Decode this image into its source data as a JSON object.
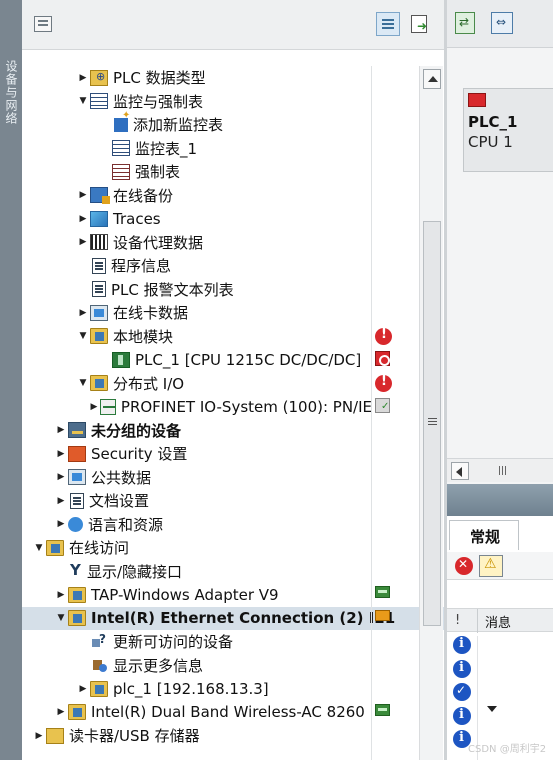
{
  "sidebar": {
    "vertical_title": "设备与网络"
  },
  "tree": {
    "items": [
      {
        "label": "PLC 数据类型",
        "icon": "plc-datatype-icon",
        "expander": "collapsed",
        "indent": 2,
        "bold": false
      },
      {
        "label": "监控与强制表",
        "icon": "watch-force-table-folder-icon",
        "expander": "expanded",
        "indent": 2,
        "bold": false
      },
      {
        "label": "添加新监控表",
        "icon": "add-watch-table-icon",
        "expander": "none",
        "indent": 3,
        "bold": false
      },
      {
        "label": "监控表_1",
        "icon": "watch-table-icon",
        "expander": "none",
        "indent": 3,
        "bold": false
      },
      {
        "label": "强制表",
        "icon": "force-table-icon",
        "expander": "none",
        "indent": 3,
        "bold": false
      },
      {
        "label": "在线备份",
        "icon": "online-backup-icon",
        "expander": "collapsed",
        "indent": 2,
        "bold": false
      },
      {
        "label": "Traces",
        "icon": "traces-icon",
        "expander": "collapsed",
        "indent": 2,
        "bold": false
      },
      {
        "label": "设备代理数据",
        "icon": "device-proxy-icon",
        "expander": "collapsed",
        "indent": 2,
        "bold": false
      },
      {
        "label": "程序信息",
        "icon": "program-info-icon",
        "expander": "none",
        "indent": 2,
        "bold": false
      },
      {
        "label": "PLC 报警文本列表",
        "icon": "alarm-text-icon",
        "expander": "none",
        "indent": 2,
        "bold": false
      },
      {
        "label": "在线卡数据",
        "icon": "memory-card-icon",
        "expander": "collapsed",
        "indent": 2,
        "bold": false
      },
      {
        "label": "本地模块",
        "icon": "folder-icon",
        "expander": "expanded",
        "indent": 2,
        "bold": false
      },
      {
        "label": "PLC_1 [CPU 1215C DC/DC/DC]",
        "icon": "plc-module-icon",
        "expander": "none",
        "indent": 3,
        "bold": false
      },
      {
        "label": "分布式 I/O",
        "icon": "folder-icon",
        "expander": "expanded",
        "indent": 2,
        "bold": false
      },
      {
        "label": "PROFINET IO-System (100): PN/IE",
        "icon": "profinet-system-icon",
        "expander": "collapsed",
        "indent": 3,
        "bold": false
      },
      {
        "label": "未分组的设备",
        "icon": "ungrouped-devices-icon",
        "expander": "collapsed",
        "indent": 1,
        "bold": true
      },
      {
        "label": "Security 设置",
        "icon": "security-icon",
        "expander": "collapsed",
        "indent": 1,
        "bold": false
      },
      {
        "label": "公共数据",
        "icon": "common-data-icon",
        "expander": "collapsed",
        "indent": 1,
        "bold": false
      },
      {
        "label": "文档设置",
        "icon": "document-settings-icon",
        "expander": "collapsed",
        "indent": 1,
        "bold": false
      },
      {
        "label": "语言和资源",
        "icon": "language-icon",
        "expander": "collapsed",
        "indent": 1,
        "bold": false
      },
      {
        "label": "在线访问",
        "icon": "online-access-folder-icon",
        "expander": "expanded",
        "indent": 0,
        "bold": false
      },
      {
        "label": "显示/隐藏接口",
        "icon": "show-hide-interfaces-icon",
        "expander": "none",
        "indent": 1,
        "bold": false
      },
      {
        "label": "TAP-Windows Adapter V9",
        "icon": "folder-icon",
        "expander": "collapsed",
        "indent": 1,
        "bold": false
      },
      {
        "label": "Intel(R) Ethernet Connection (2) I21",
        "icon": "folder-icon",
        "expander": "expanded",
        "indent": 1,
        "bold": true,
        "selected": true
      },
      {
        "label": "更新可访问的设备",
        "icon": "update-accessible-devices-icon",
        "expander": "none",
        "indent": 2,
        "bold": false
      },
      {
        "label": "显示更多信息",
        "icon": "show-more-info-icon",
        "expander": "none",
        "indent": 2,
        "bold": false
      },
      {
        "label": "plc_1 [192.168.13.3]",
        "icon": "plc-online-icon",
        "expander": "collapsed",
        "indent": 2,
        "bold": false
      },
      {
        "label": "Intel(R) Dual Band Wireless-AC 8260",
        "icon": "folder-icon",
        "expander": "collapsed",
        "indent": 1,
        "bold": false
      },
      {
        "label": "读卡器/USB 存储器",
        "icon": "card-reader-icon",
        "expander": "collapsed",
        "indent": 0,
        "bold": false
      }
    ]
  },
  "status_icons": [
    {
      "row": 11,
      "type": "error-icon"
    },
    {
      "row": 12,
      "type": "plc-error-status-icon"
    },
    {
      "row": 13,
      "type": "error-icon"
    },
    {
      "row": 14,
      "type": "network-ok-icon"
    },
    {
      "row": 22,
      "type": "adapter-status-icon"
    },
    {
      "row": 23,
      "type": "connection-status-icon"
    },
    {
      "row": 27,
      "type": "adapter-status-icon"
    }
  ],
  "right_pane": {
    "device_name": "PLC_1",
    "device_type": "CPU 1"
  },
  "inspector": {
    "tab_general": "常规",
    "col_excl": "!",
    "col_message": "消息",
    "messages": [
      "info",
      "info",
      "ok",
      "info",
      "info"
    ]
  },
  "watermark": "CSDN @周利宇2",
  "colors": {
    "selection": "#d5dfe8",
    "error": "#d8282c",
    "info": "#1d55c2",
    "strip": "#7a8690"
  }
}
